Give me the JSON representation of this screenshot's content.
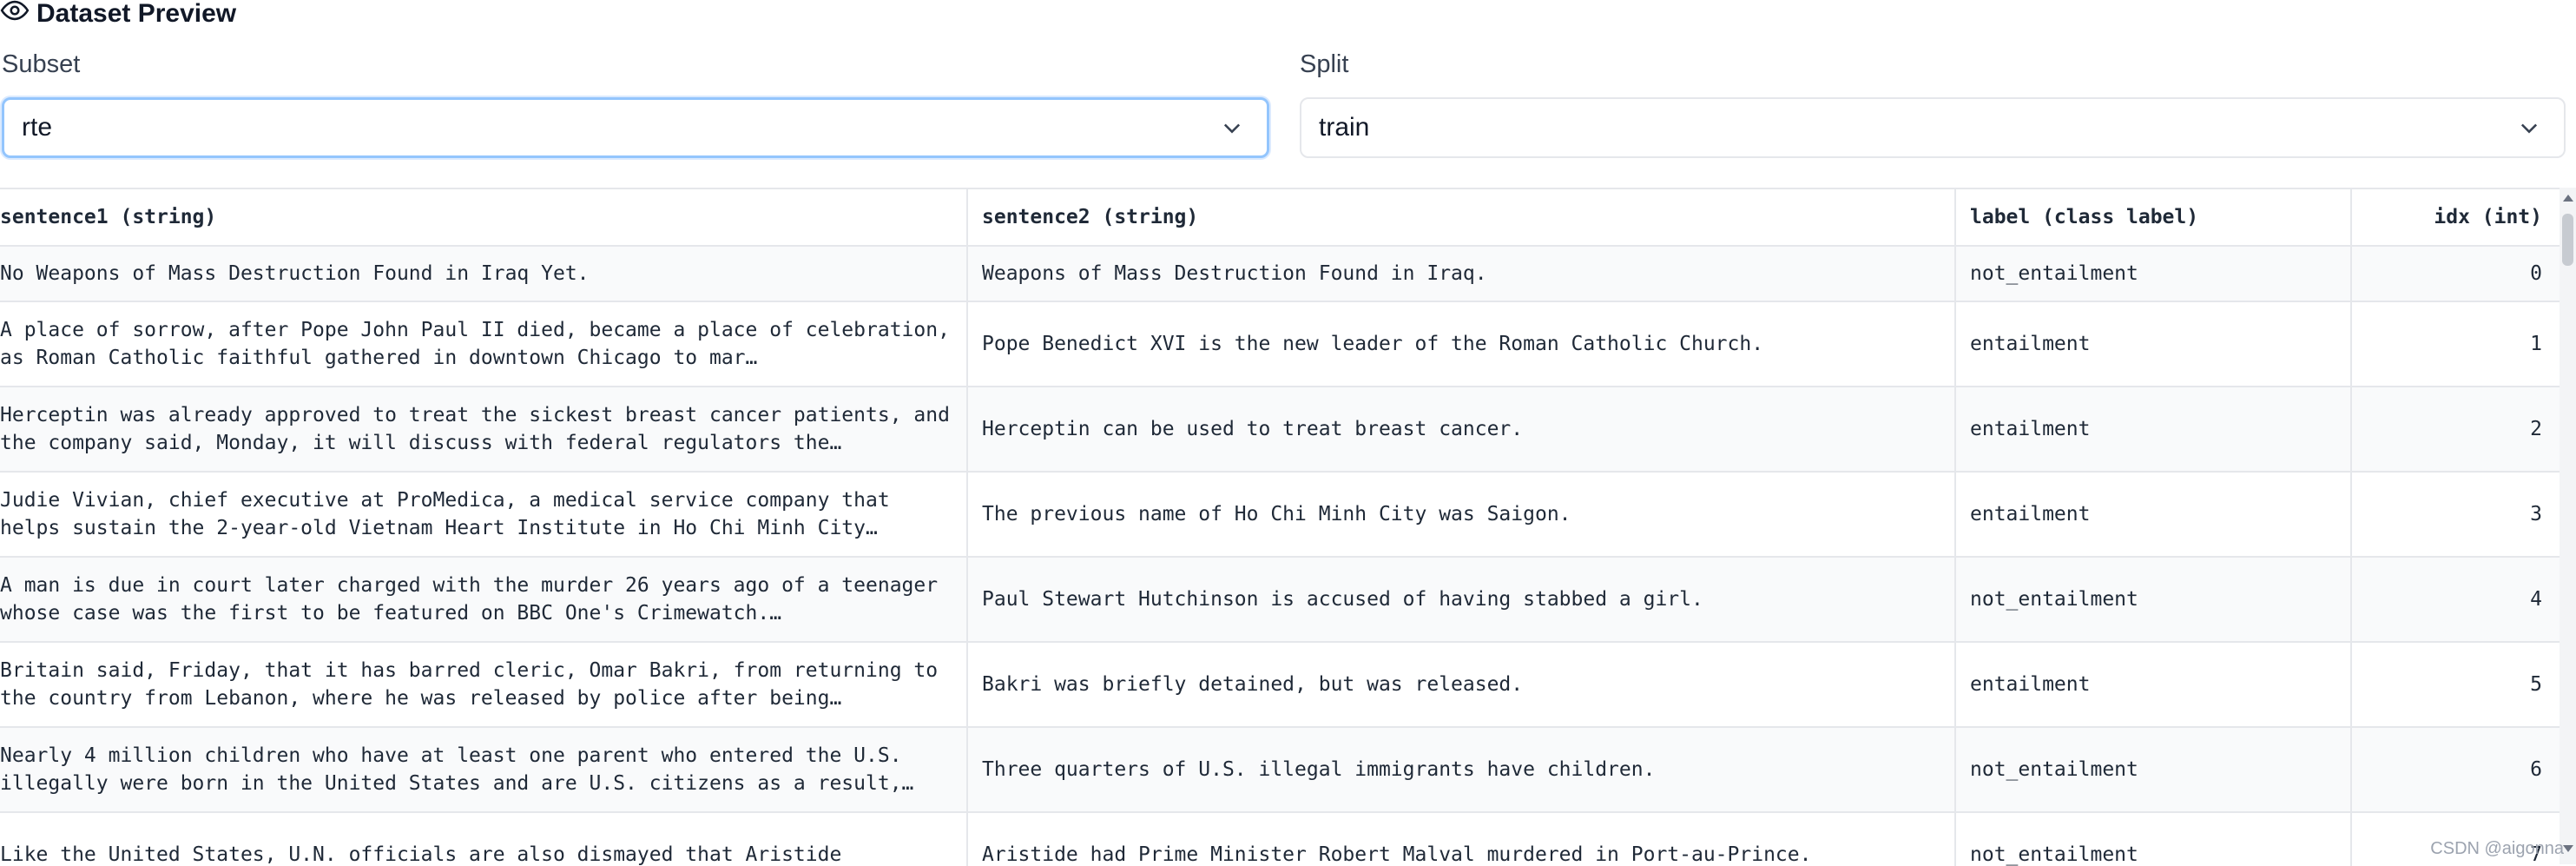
{
  "header": {
    "title": "Dataset Preview",
    "icon": "eye-icon"
  },
  "subset": {
    "label": "Subset",
    "value": "rte"
  },
  "split": {
    "label": "Split",
    "value": "train"
  },
  "table": {
    "columns": [
      "sentence1 (string)",
      "sentence2 (string)",
      "label (class label)",
      "idx (int)"
    ],
    "rows": [
      {
        "s1": "No Weapons of Mass Destruction Found in Iraq Yet.",
        "s2": "Weapons of Mass Destruction Found in Iraq.",
        "label": "not_entailment",
        "idx": "0"
      },
      {
        "s1": "A place of sorrow, after Pope John Paul II died, became a place of celebration, as Roman Catholic faithful gathered in downtown Chicago to mar…",
        "s2": "Pope Benedict XVI is the new leader of the Roman Catholic Church.",
        "label": "entailment",
        "idx": "1"
      },
      {
        "s1": "Herceptin was already approved to treat the sickest breast cancer patients, and the company said, Monday, it will discuss with federal regulators the…",
        "s2": "Herceptin can be used to treat breast cancer.",
        "label": "entailment",
        "idx": "2"
      },
      {
        "s1": "Judie Vivian, chief executive at ProMedica, a medical service company that helps sustain the 2-year-old Vietnam Heart Institute in Ho Chi Minh City…",
        "s2": "The previous name of Ho Chi Minh City was Saigon.",
        "label": "entailment",
        "idx": "3"
      },
      {
        "s1": "A man is due in court later charged with the murder 26 years ago of a teenager whose case was the first to be featured on BBC One's Crimewatch.…",
        "s2": "Paul Stewart Hutchinson is accused of having stabbed a girl.",
        "label": "not_entailment",
        "idx": "4"
      },
      {
        "s1": "Britain said, Friday, that it has barred cleric, Omar Bakri, from returning to the country from Lebanon, where he was released by police after being…",
        "s2": "Bakri was briefly detained, but was released.",
        "label": "entailment",
        "idx": "5"
      },
      {
        "s1": "Nearly 4 million children who have at least one parent who entered the U.S. illegally were born in the United States and are U.S. citizens as a result,…",
        "s2": "Three quarters of U.S. illegal immigrants have children.",
        "label": "not_entailment",
        "idx": "6"
      },
      {
        "s1": "Like the United States, U.N. officials are also dismayed that Aristide",
        "s2": "Aristide had Prime Minister Robert Malval murdered in Port-au-Prince.",
        "label": "not_entailment",
        "idx": "7"
      }
    ]
  },
  "watermark": "CSDN @aigonna"
}
